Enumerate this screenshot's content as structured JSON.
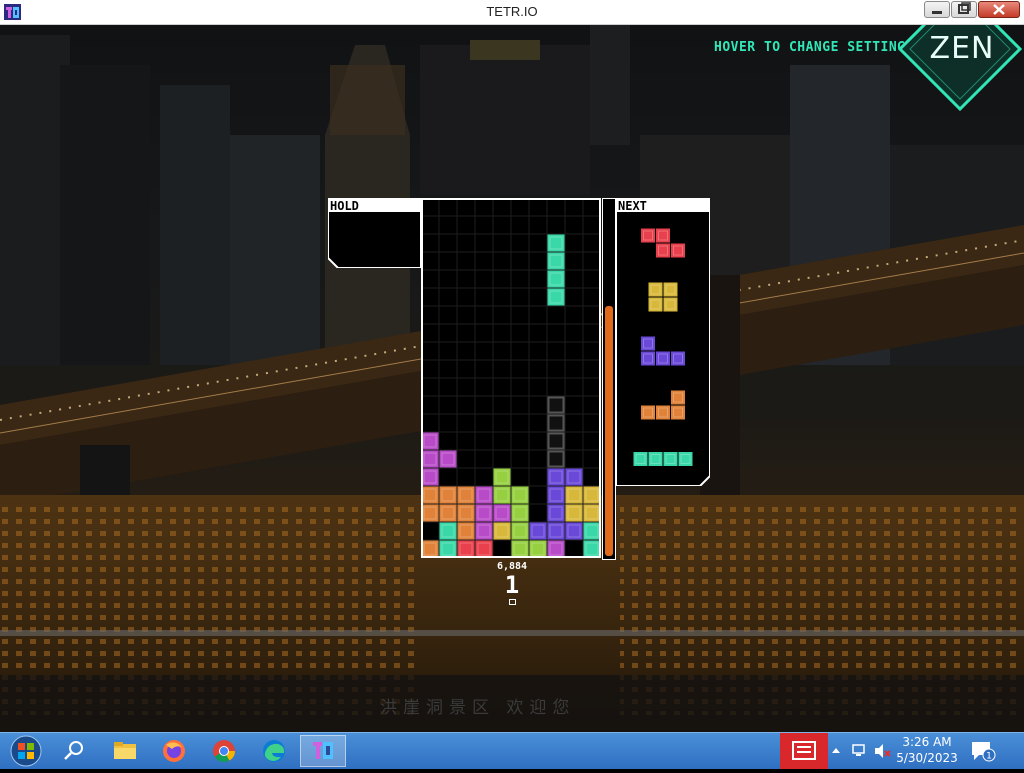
{
  "window": {
    "title": "TETR.IO"
  },
  "game": {
    "hover_hint": "HOVER TO CHANGE SETTINGS",
    "mode": "ZEN",
    "hold_label": "HOLD",
    "next_label": "NEXT",
    "score": "6,884",
    "lines": "1",
    "watermark": "洪崖洞景区 欢迎您",
    "colors": {
      "Z": "#e8404c",
      "O": "#d8b83a",
      "J": "#6a48d8",
      "L": "#e0823a",
      "I": "#3ad8a8",
      "T": "#b84cc8",
      "S": "#96d040",
      "G": "#666666",
      "accent": "#31e7b8",
      "meter": "#e06a1a"
    },
    "board": {
      "cols": 10,
      "rows": 20,
      "active_piece": {
        "type": "I",
        "cells": [
          [
            7,
            2
          ],
          [
            7,
            3
          ],
          [
            7,
            4
          ],
          [
            7,
            5
          ]
        ]
      },
      "ghost_piece": {
        "cells": [
          [
            7,
            11
          ],
          [
            7,
            12
          ],
          [
            7,
            13
          ],
          [
            7,
            14
          ]
        ]
      },
      "cells": [
        [
          0,
          13,
          "T"
        ],
        [
          0,
          14,
          "T"
        ],
        [
          1,
          14,
          "T"
        ],
        [
          0,
          15,
          "T"
        ],
        [
          4,
          15,
          "S"
        ],
        [
          7,
          15,
          "J"
        ],
        [
          8,
          15,
          "J"
        ],
        [
          0,
          16,
          "L"
        ],
        [
          1,
          16,
          "L"
        ],
        [
          2,
          16,
          "L"
        ],
        [
          3,
          16,
          "T"
        ],
        [
          4,
          16,
          "S"
        ],
        [
          5,
          16,
          "S"
        ],
        [
          7,
          16,
          "J"
        ],
        [
          8,
          16,
          "O"
        ],
        [
          9,
          16,
          "O"
        ],
        [
          0,
          17,
          "L"
        ],
        [
          1,
          17,
          "L"
        ],
        [
          2,
          17,
          "L"
        ],
        [
          3,
          17,
          "T"
        ],
        [
          4,
          17,
          "T"
        ],
        [
          5,
          17,
          "S"
        ],
        [
          7,
          17,
          "J"
        ],
        [
          8,
          17,
          "O"
        ],
        [
          9,
          17,
          "O"
        ],
        [
          1,
          18,
          "I"
        ],
        [
          2,
          18,
          "L"
        ],
        [
          3,
          18,
          "T"
        ],
        [
          4,
          18,
          "O"
        ],
        [
          5,
          18,
          "S"
        ],
        [
          6,
          18,
          "J"
        ],
        [
          7,
          18,
          "J"
        ],
        [
          8,
          18,
          "J"
        ],
        [
          9,
          18,
          "I"
        ],
        [
          0,
          19,
          "L"
        ],
        [
          1,
          19,
          "I"
        ],
        [
          2,
          19,
          "Z"
        ],
        [
          3,
          19,
          "Z"
        ],
        [
          5,
          19,
          "S"
        ],
        [
          6,
          19,
          "S"
        ],
        [
          7,
          19,
          "T"
        ],
        [
          9,
          19,
          "I"
        ]
      ]
    },
    "next_queue": [
      {
        "type": "Z",
        "cells": [
          [
            0,
            0
          ],
          [
            1,
            0
          ],
          [
            1,
            1
          ],
          [
            2,
            1
          ]
        ]
      },
      {
        "type": "O",
        "cells": [
          [
            0,
            0
          ],
          [
            1,
            0
          ],
          [
            0,
            1
          ],
          [
            1,
            1
          ]
        ]
      },
      {
        "type": "J",
        "cells": [
          [
            0,
            0
          ],
          [
            0,
            1
          ],
          [
            1,
            1
          ],
          [
            2,
            1
          ]
        ]
      },
      {
        "type": "L",
        "cells": [
          [
            2,
            0
          ],
          [
            0,
            1
          ],
          [
            1,
            1
          ],
          [
            2,
            1
          ]
        ]
      },
      {
        "type": "I",
        "cells": [
          [
            0,
            0
          ],
          [
            1,
            0
          ],
          [
            2,
            0
          ],
          [
            3,
            0
          ]
        ]
      }
    ],
    "garbage_meter_fraction": 0.7
  },
  "taskbar": {
    "items": [
      {
        "icon": "windows-start-icon"
      },
      {
        "icon": "search-icon"
      },
      {
        "icon": "file-explorer-icon"
      },
      {
        "icon": "firefox-icon"
      },
      {
        "icon": "chrome-icon"
      },
      {
        "icon": "edge-icon"
      },
      {
        "icon": "tetrio-icon"
      }
    ],
    "time": "3:26 AM",
    "date": "5/30/2023",
    "notification_count": "1"
  }
}
